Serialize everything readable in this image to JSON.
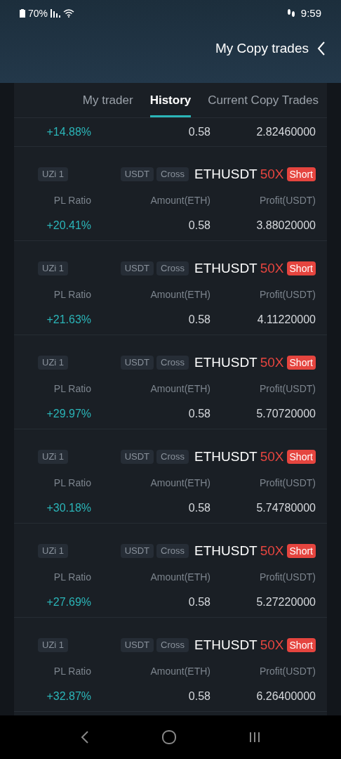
{
  "status_bar": {
    "time": "9:59",
    "battery": "70%"
  },
  "header": {
    "title": "My Copy trades"
  },
  "tabs": [
    {
      "label": "My trader",
      "selected": false
    },
    {
      "label": "History",
      "selected": true
    },
    {
      "label": "Current Copy Trades",
      "selected": false
    }
  ],
  "partial_row": {
    "profit": "2.82460000",
    "amount": "0.58",
    "ratio": "+14.88%"
  },
  "trades": [
    {
      "side": "Short",
      "leverage": "50X",
      "symbol": "ETHUSDT",
      "margin": "Cross",
      "settle": "USDT",
      "trader": "UZi 1",
      "labels": [
        "PL Ratio",
        "Amount(ETH)",
        "Profit(USDT)"
      ],
      "profit": "3.88020000",
      "amount": "0.58",
      "ratio": "+20.41%"
    },
    {
      "side": "Short",
      "leverage": "50X",
      "symbol": "ETHUSDT",
      "margin": "Cross",
      "settle": "USDT",
      "trader": "UZi 1",
      "labels": [
        "PL Ratio",
        "Amount(ETH)",
        "Profit(USDT)"
      ],
      "profit": "4.11220000",
      "amount": "0.58",
      "ratio": "+21.63%"
    },
    {
      "side": "Short",
      "leverage": "50X",
      "symbol": "ETHUSDT",
      "margin": "Cross",
      "settle": "USDT",
      "trader": "UZi 1",
      "labels": [
        "PL Ratio",
        "Amount(ETH)",
        "Profit(USDT)"
      ],
      "profit": "5.70720000",
      "amount": "0.58",
      "ratio": "+29.97%"
    },
    {
      "side": "Short",
      "leverage": "50X",
      "symbol": "ETHUSDT",
      "margin": "Cross",
      "settle": "USDT",
      "trader": "UZi 1",
      "labels": [
        "PL Ratio",
        "Amount(ETH)",
        "Profit(USDT)"
      ],
      "profit": "5.74780000",
      "amount": "0.58",
      "ratio": "+30.18%"
    },
    {
      "side": "Short",
      "leverage": "50X",
      "symbol": "ETHUSDT",
      "margin": "Cross",
      "settle": "USDT",
      "trader": "UZi 1",
      "labels": [
        "PL Ratio",
        "Amount(ETH)",
        "Profit(USDT)"
      ],
      "profit": "5.27220000",
      "amount": "0.58",
      "ratio": "+27.69%"
    },
    {
      "side": "Short",
      "leverage": "50X",
      "symbol": "ETHUSDT",
      "margin": "Cross",
      "settle": "USDT",
      "trader": "UZi 1",
      "labels": [
        "PL Ratio",
        "Amount(ETH)",
        "Profit(USDT)"
      ],
      "profit": "6.26400000",
      "amount": "0.58",
      "ratio": "+32.87%"
    }
  ]
}
